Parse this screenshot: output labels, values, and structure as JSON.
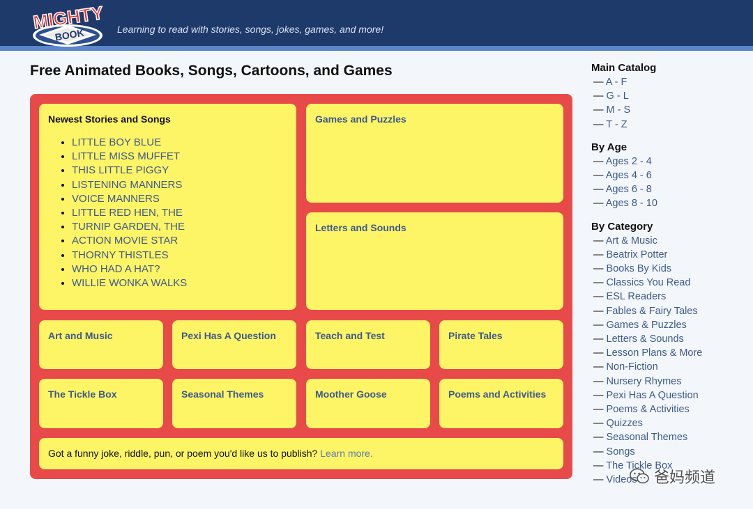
{
  "header": {
    "logo_text_top": "MIGHTY",
    "logo_text_bottom": "BOOK",
    "tagline": "Learning to read with stories, songs, jokes, games, and more!"
  },
  "page": {
    "title": "Free Animated Books, Songs, Cartoons, and Games"
  },
  "board": {
    "newest": {
      "title": "Newest Stories and Songs",
      "items": [
        "LITTLE BOY BLUE",
        "LITTLE MISS MUFFET",
        "THIS LITTLE PIGGY",
        "LISTENING MANNERS",
        "VOICE MANNERS",
        "LITTLE RED HEN, THE",
        "TURNIP GARDEN, THE",
        "ACTION MOVIE STAR",
        "THORNY THISTLES",
        "WHO HAD A HAT?",
        "WILLIE WONKA WALKS"
      ]
    },
    "games_puzzles": "Games and Puzzles",
    "letters_sounds": "Letters and Sounds",
    "art_music": "Art and Music",
    "pexi": "Pexi Has A Question",
    "teach_test": "Teach and Test",
    "pirate": "Pirate Tales",
    "tickle": "The Tickle Box",
    "seasonal": "Seasonal Themes",
    "moother": "Moother Goose",
    "poems": "Poems and Activities",
    "joke_text": "Got a funny joke, riddle, pun, or poem you'd like us to publish?",
    "joke_link": "Learn more."
  },
  "sidebar": {
    "dash": "—",
    "main_catalog": {
      "heading": "Main Catalog",
      "items": [
        "A - F",
        "G - L",
        "M - S",
        "T - Z"
      ]
    },
    "by_age": {
      "heading": "By Age",
      "items": [
        "Ages 2 - 4",
        "Ages 4 - 6",
        "Ages 6 - 8",
        "Ages 8 - 10"
      ]
    },
    "by_category": {
      "heading": "By Category",
      "items": [
        "Art & Music",
        "Beatrix Potter",
        "Books By Kids",
        "Classics You Read",
        "ESL Readers",
        "Fables & Fairy Tales",
        "Games & Puzzles",
        "Letters & Sounds",
        "Lesson Plans & More",
        "Non-Fiction",
        "Nursery Rhymes",
        "Pexi Has A Question",
        "Poems & Activities",
        "Quizzes",
        "Seasonal Themes",
        "Songs",
        "The Tickle Box",
        "Videos"
      ]
    }
  },
  "watermark": {
    "text": "爸妈频道"
  },
  "colors": {
    "header_bg": "#1e3a6a",
    "header_stripe": "#5b86c7",
    "board_red": "#e84a4a",
    "tile_yellow": "#fdf466",
    "link_blue": "#3d5a8c"
  }
}
